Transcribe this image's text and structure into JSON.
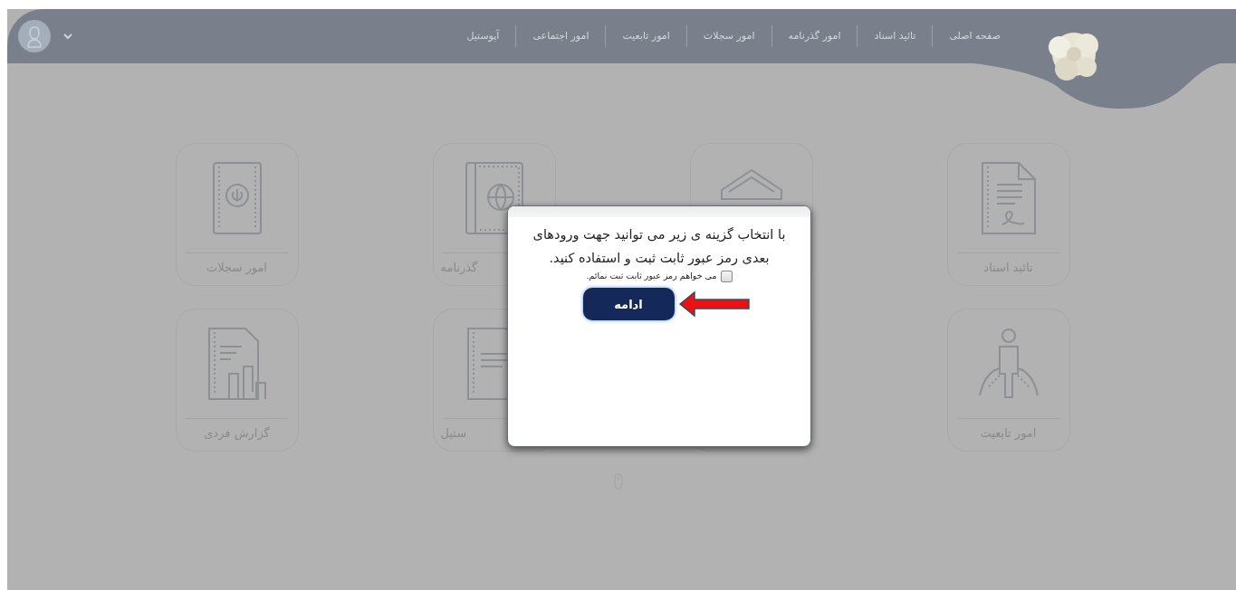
{
  "header": {
    "nav": [
      {
        "label": "صفحه اصلی"
      },
      {
        "label": "تائید اسناد"
      },
      {
        "label": "امور گذرنامه"
      },
      {
        "label": "امور سجلات"
      },
      {
        "label": "امور تابعیت"
      },
      {
        "label": "امور اجتماعی"
      },
      {
        "label": "آپوستیل"
      }
    ]
  },
  "cards": [
    {
      "kind": "card",
      "label": "تائید اسناد"
    },
    {
      "kind": "partial"
    },
    {
      "kind": "partial",
      "label": "گذرنامه"
    },
    {
      "kind": "card",
      "label": "امور سجلات"
    },
    {
      "kind": "card",
      "label": "امور تابعیت"
    },
    {
      "kind": "covered"
    },
    {
      "kind": "partial",
      "label": "ستیل"
    },
    {
      "kind": "card",
      "label": "گزارش فردی"
    }
  ],
  "dialog": {
    "message": "با انتخاب گزینه ی زیر می توانید جهت ورودهای بعدی رمز عبور ثابت ثبت و استفاده کنید.",
    "checkbox": {
      "label": "می خواهم رمز عبور ثابت ثبت نمائم.",
      "checked": false
    },
    "button": "ادامه"
  }
}
